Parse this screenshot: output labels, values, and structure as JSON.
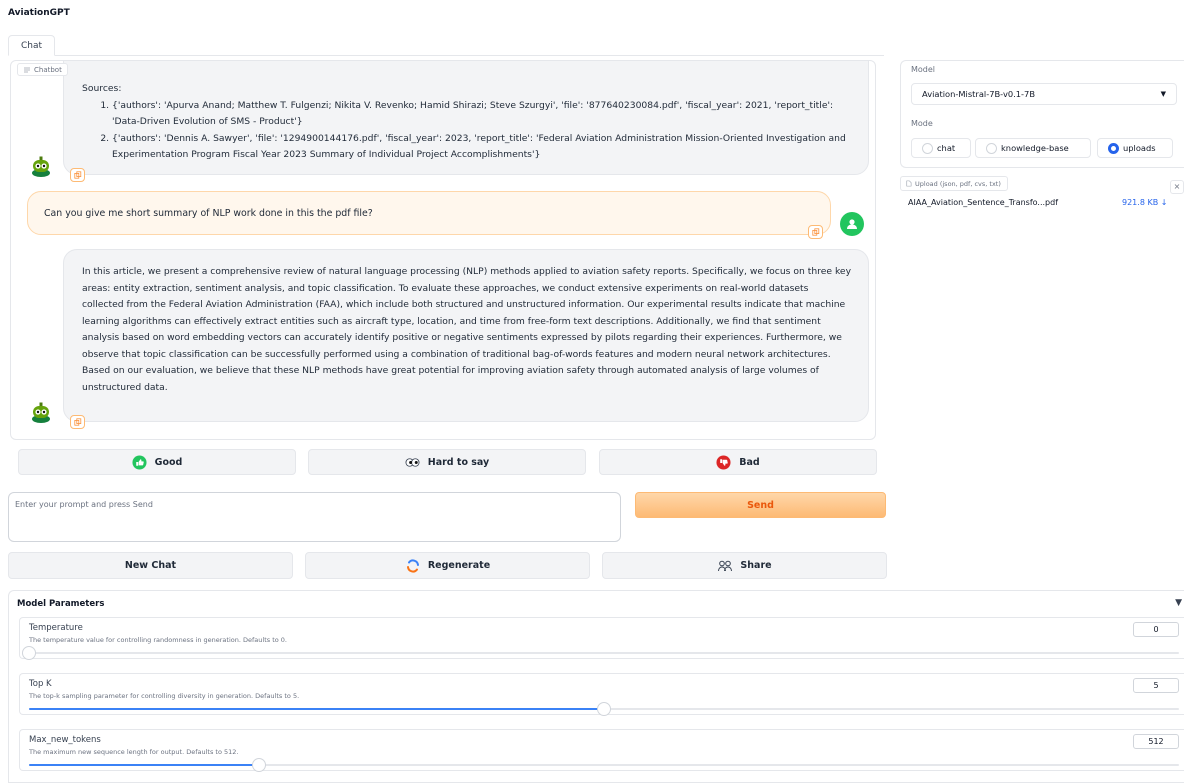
{
  "app": {
    "title": "AviationGPT"
  },
  "tabs": [
    {
      "label": "Chat"
    }
  ],
  "chatbot": {
    "label": "Chatbot",
    "messages": [
      {
        "role": "bot",
        "sources_title": "Sources:",
        "sources": [
          "{'authors': 'Apurva Anand; Matthew T. Fulgenzi; Nikita V. Revenko; Hamid Shirazi; Steve Szurgyi', 'file': '877640230084.pdf', 'fiscal_year': 2021, 'report_title': 'Data-Driven Evolution of SMS - Product'}",
          "{'authors': 'Dennis A. Sawyer', 'file': '1294900144176.pdf', 'fiscal_year': 2023, 'report_title': 'Federal Aviation Administration Mission-Oriented Investigation and Experimentation Program Fiscal Year 2023 Summary of Individual Project Accomplishments'}"
        ]
      },
      {
        "role": "user",
        "text": "Can you give me short summary of NLP work done in this the pdf file?"
      },
      {
        "role": "bot",
        "text": "In this article, we present a comprehensive review of natural language processing (NLP) methods applied to aviation safety reports. Specifically, we focus on three key areas: entity extraction, sentiment analysis, and topic classification. To evaluate these approaches, we conduct extensive experiments on real-world datasets collected from the Federal Aviation Administration (FAA), which include both structured and unstructured information. Our experimental results indicate that machine learning algorithms can effectively extract entities such as aircraft type, location, and time from free-form text descriptions. Additionally, we find that sentiment analysis based on word embedding vectors can accurately identify positive or negative sentiments expressed by pilots regarding their experiences. Furthermore, we observe that topic classification can be successfully performed using a combination of traditional bag-of-words features and modern neural network architectures. Based on our evaluation, we believe that these NLP methods have great potential for improving aviation safety through automated analysis of large volumes of unstructured data."
      }
    ]
  },
  "feedback": {
    "good": "Good",
    "hard": "Hard to say",
    "bad": "Bad"
  },
  "prompt": {
    "placeholder": "Enter your prompt and press Send",
    "value": ""
  },
  "send_label": "Send",
  "actions": {
    "new_chat": "New Chat",
    "regenerate": "Regenerate",
    "share": "Share"
  },
  "model_params": {
    "title": "Model Parameters",
    "collapse_icon": "▼",
    "params": [
      {
        "name": "Temperature",
        "desc": "The temperature value for controlling randomness in generation. Defaults to 0.",
        "value": "0",
        "fraction": 0.0
      },
      {
        "name": "Top K",
        "desc": "The top-k sampling parameter for controlling diversity in generation. Defaults to 5.",
        "value": "5",
        "fraction": 0.5
      },
      {
        "name": "Max_new_tokens",
        "desc": "The maximum new sequence length for output. Defaults to 512.",
        "value": "512",
        "fraction": 0.2
      }
    ]
  },
  "sidebar": {
    "model_label": "Model",
    "model_value": "Aviation-Mistral-7B-v0.1-7B",
    "mode_label": "Mode",
    "modes": [
      {
        "label": "chat",
        "selected": false
      },
      {
        "label": "knowledge-base",
        "selected": false
      },
      {
        "label": "uploads",
        "selected": true
      }
    ]
  },
  "upload": {
    "label": "Upload (json, pdf, cvs, txt)",
    "close": "×",
    "file_name": "AIAA_Aviation_Sentence_Transfo...pdf",
    "file_size": "921.8 KB ↓"
  },
  "colors": {
    "accent": "#f97316",
    "user_bubble": "#fff7ed",
    "slider": "#3b82f6",
    "selected_radio": "#2563eb"
  }
}
